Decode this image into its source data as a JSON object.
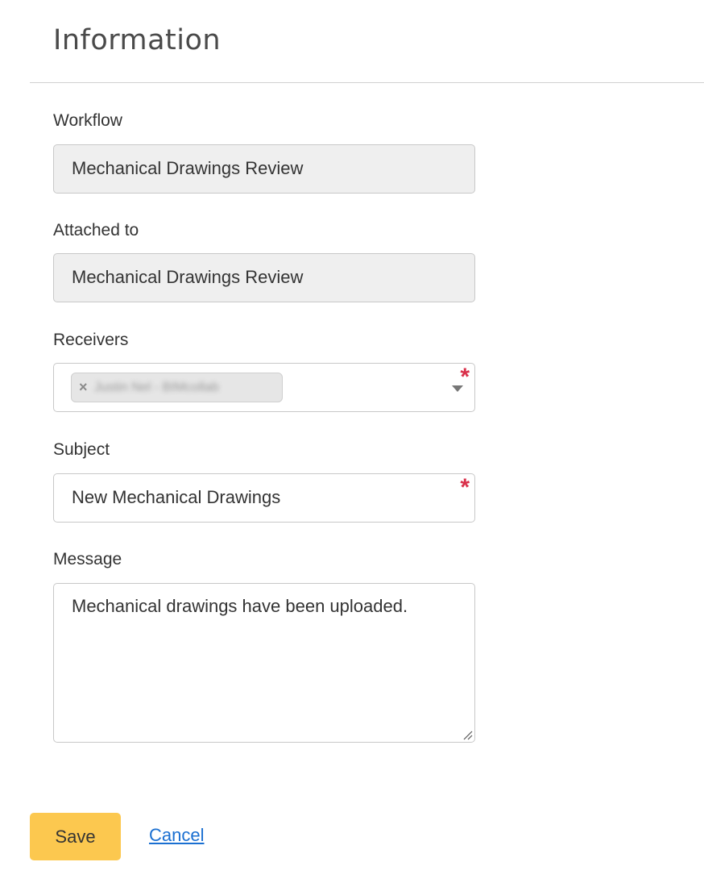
{
  "header": {
    "title": "Information"
  },
  "form": {
    "workflow": {
      "label": "Workflow",
      "value": "Mechanical Drawings Review"
    },
    "attached_to": {
      "label": "Attached to",
      "value": "Mechanical Drawings Review"
    },
    "receivers": {
      "label": "Receivers",
      "chip_remove": "×",
      "chips": [
        {
          "text": "Justin Nel - BIMcollab"
        }
      ],
      "required_mark": "*"
    },
    "subject": {
      "label": "Subject",
      "value": "New Mechanical Drawings",
      "required_mark": "*"
    },
    "message": {
      "label": "Message",
      "value": "Mechanical drawings have been uploaded."
    }
  },
  "actions": {
    "save_label": "Save",
    "cancel_label": "Cancel"
  },
  "colors": {
    "accent": "#fcc84f",
    "link": "#1a6fd1",
    "required": "#d9304a",
    "readonly_background": "#efefef"
  },
  "icons": {
    "chip_remove": "close-icon",
    "dropdown": "chevron-down-icon",
    "resize": "resize-handle-icon"
  }
}
